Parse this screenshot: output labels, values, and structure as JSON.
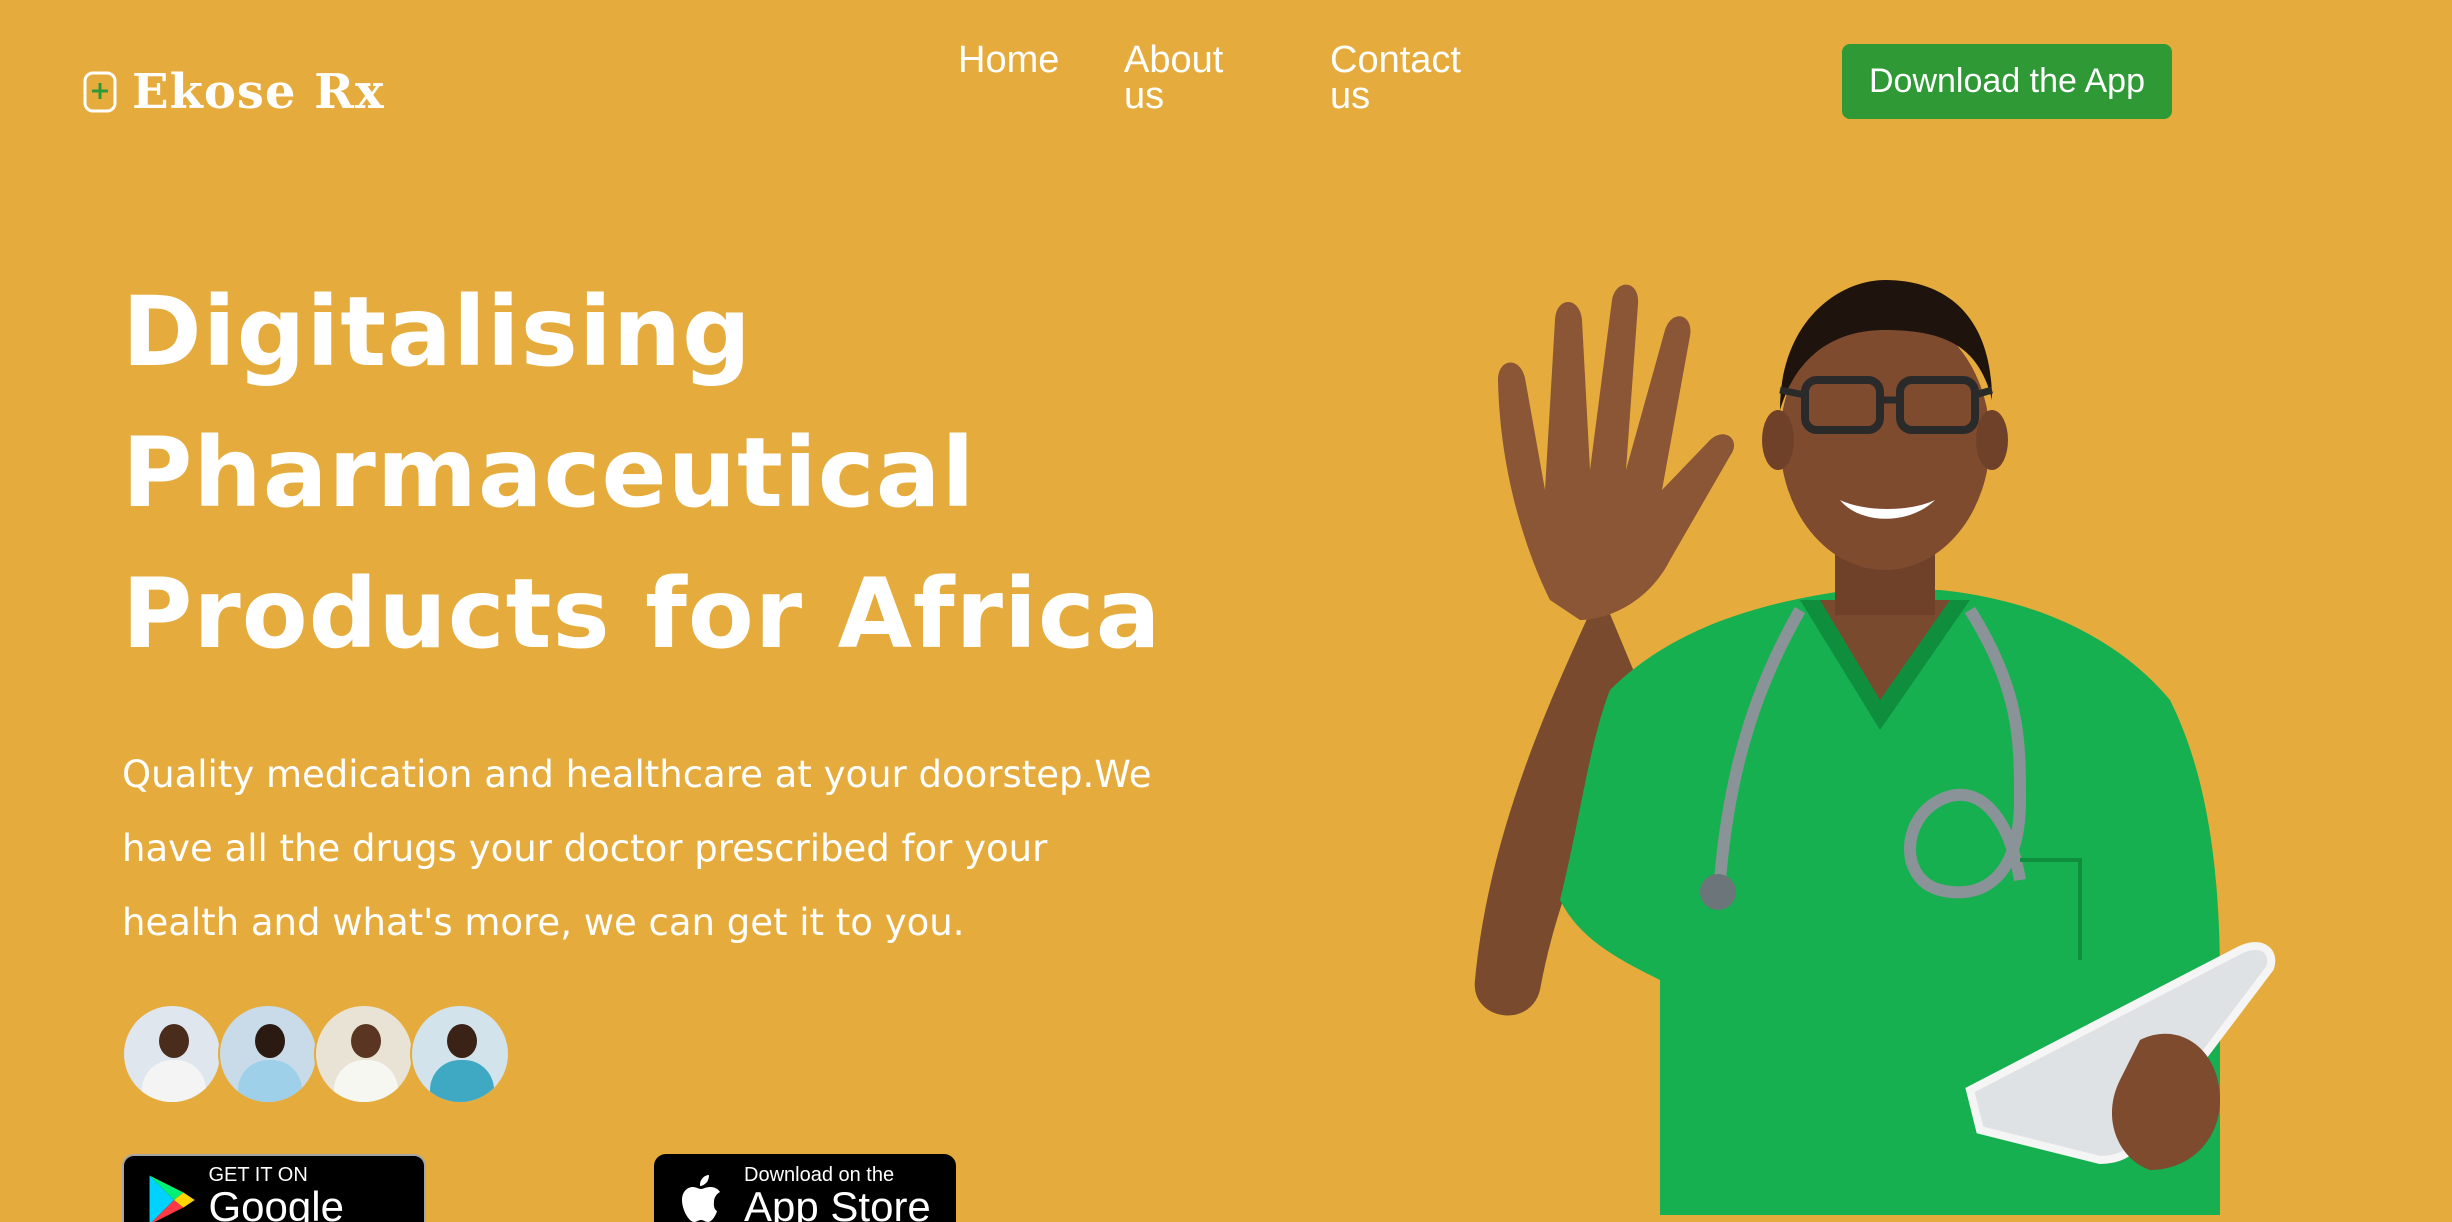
{
  "header": {
    "brand": "Ekose Rx",
    "nav": {
      "home": "Home",
      "about": "About us",
      "contact": "Contact us"
    },
    "cta_label": "Download the App"
  },
  "hero": {
    "headline": "Digitalising Pharmaceutical Products for Africa",
    "subtext": "Quality medication and healthcare at your doorstep.We have all the drugs your doctor prescribed for your health and what's more, we can get it to you."
  },
  "badges": {
    "google_play": {
      "small": "GET IT ON",
      "big": "Google Play"
    },
    "app_store": {
      "small": "Download on the",
      "big": "App Store"
    }
  },
  "colors": {
    "background": "#e5ac3d",
    "cta": "#2f9a35",
    "scrubs": "#16b050"
  }
}
